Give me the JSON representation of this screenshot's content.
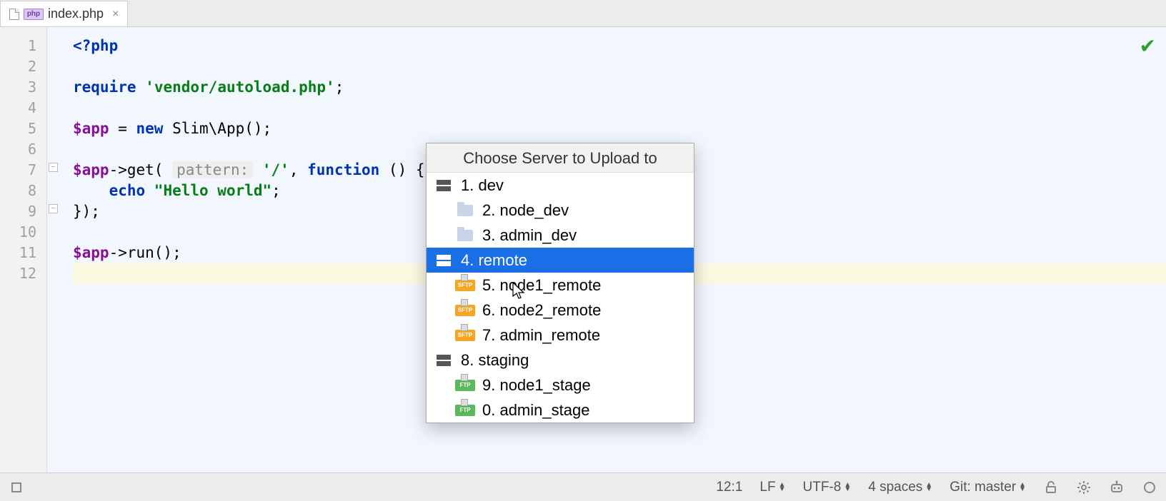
{
  "tab": {
    "filename": "index.php",
    "icon_badge": "php"
  },
  "gutter": {
    "lines": [
      "1",
      "2",
      "3",
      "4",
      "5",
      "6",
      "7",
      "8",
      "9",
      "10",
      "11",
      "12"
    ]
  },
  "code": {
    "l1_open": "<?php",
    "l3_require": "require",
    "l3_str": "'vendor/autoload.php'",
    "l3_end": ";",
    "l5_var": "$app",
    "l5_eq": " = ",
    "l5_new": "new",
    "l5_cls": " Slim\\App();",
    "l7_var": "$app",
    "l7_arrow": "->get( ",
    "l7_hint": "pattern:",
    "l7_str": " '/'",
    "l7_mid": ", ",
    "l7_fn": "function",
    "l7_end": " () {",
    "l8_pad": "    ",
    "l8_echo": "echo",
    "l8_str": " \"Hello world\"",
    "l8_end": ";",
    "l9": "});",
    "l11_var": "$app",
    "l11_rest": "->run();"
  },
  "popup": {
    "title": "Choose Server to Upload to",
    "items": [
      {
        "label": "1. dev",
        "icon": "server",
        "indent": false,
        "selected": false
      },
      {
        "label": "2. node_dev",
        "icon": "folder",
        "indent": true,
        "selected": false
      },
      {
        "label": "3. admin_dev",
        "icon": "folder",
        "indent": true,
        "selected": false
      },
      {
        "label": "4. remote",
        "icon": "server",
        "indent": false,
        "selected": true
      },
      {
        "label": "5. node1_remote",
        "icon": "sftp",
        "indent": true,
        "selected": false
      },
      {
        "label": "6. node2_remote",
        "icon": "sftp",
        "indent": true,
        "selected": false
      },
      {
        "label": "7. admin_remote",
        "icon": "sftp",
        "indent": true,
        "selected": false
      },
      {
        "label": "8. staging",
        "icon": "server",
        "indent": false,
        "selected": false
      },
      {
        "label": "9. node1_stage",
        "icon": "ftp",
        "indent": true,
        "selected": false
      },
      {
        "label": "0. admin_stage",
        "icon": "ftp",
        "indent": true,
        "selected": false
      }
    ]
  },
  "status": {
    "position": "12:1",
    "line_sep": "LF",
    "encoding": "UTF-8",
    "indent": "4 spaces",
    "git_label": "Git: master"
  },
  "icons": {
    "sftp_badge": "SFTP",
    "ftp_badge": "FTP"
  }
}
